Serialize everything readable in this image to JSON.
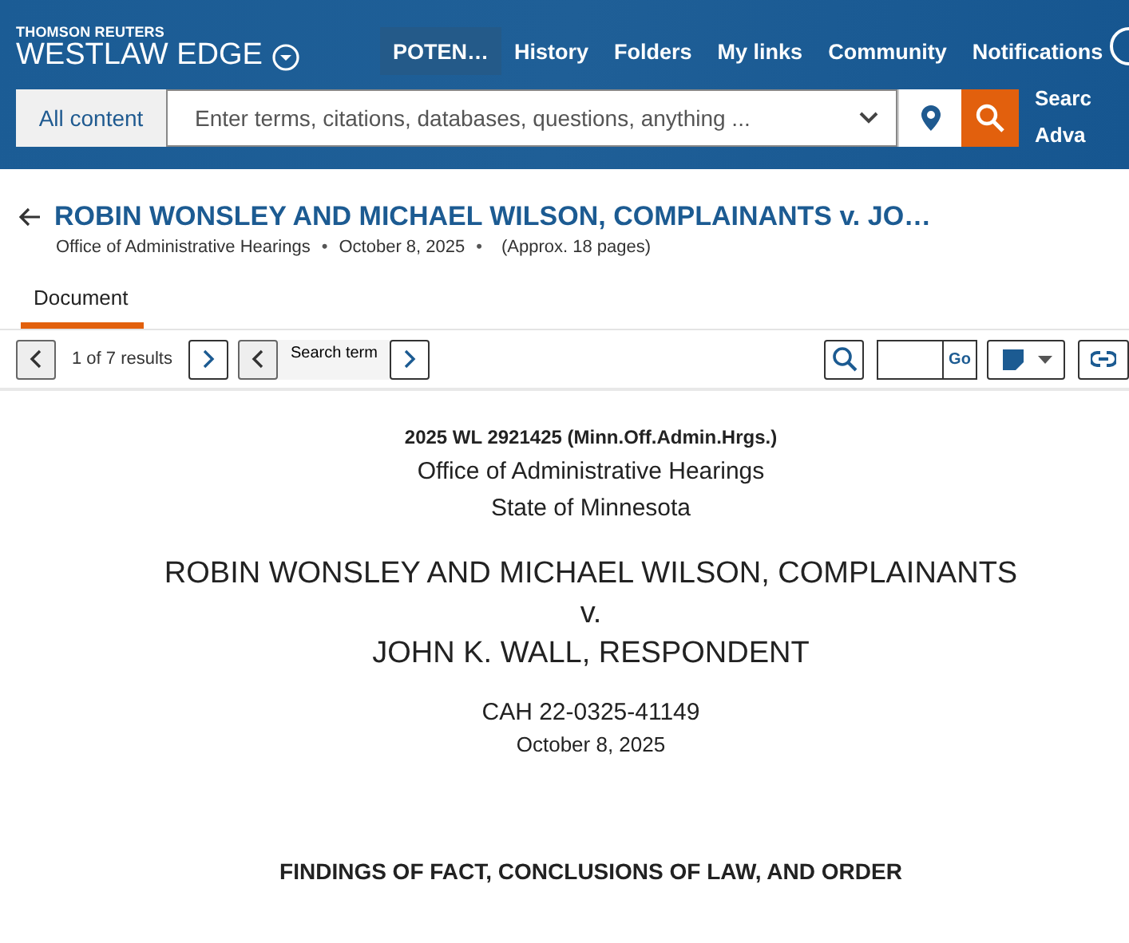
{
  "header": {
    "brand_top": "THOMSON REUTERS",
    "brand_main": "WESTLAW EDGE",
    "nav": [
      {
        "label": "POTEN…",
        "selected": true
      },
      {
        "label": "History",
        "selected": false
      },
      {
        "label": "Folders",
        "selected": false
      },
      {
        "label": "My links",
        "selected": false
      },
      {
        "label": "Community",
        "selected": false
      },
      {
        "label": "Notifications",
        "selected": false
      }
    ],
    "search": {
      "scope": "All content",
      "placeholder": "Enter terms, citations, databases, questions, anything ..."
    },
    "side_links": [
      "Searc",
      "Adva"
    ]
  },
  "document_header": {
    "title": "ROBIN WONSLEY AND MICHAEL WILSON, COMPLAINANTS v. JO…",
    "separator": "•",
    "meta": [
      "Office of Administrative Hearings",
      "October 8, 2025",
      "(Approx. 18 pages)"
    ]
  },
  "tabs": [
    {
      "label": "Document",
      "selected": true
    }
  ],
  "toolbar": {
    "results": "1 of 7 results",
    "search_term": "Search term",
    "go": "Go"
  },
  "document": {
    "citation": "2025 WL 2921425 (Minn.Off.Admin.Hrgs.)",
    "court": "Office of Administrative Hearings",
    "state": "State of Minnesota",
    "parties": [
      "ROBIN WONSLEY AND MICHAEL WILSON, COMPLAINANTS",
      "v.",
      "JOHN K. WALL, RESPONDENT"
    ],
    "docket": "CAH 22-0325-41149",
    "date": "October 8, 2025",
    "heading": "FINDINGS OF FACT, CONCLUSIONS OF LAW, AND ORDER"
  }
}
